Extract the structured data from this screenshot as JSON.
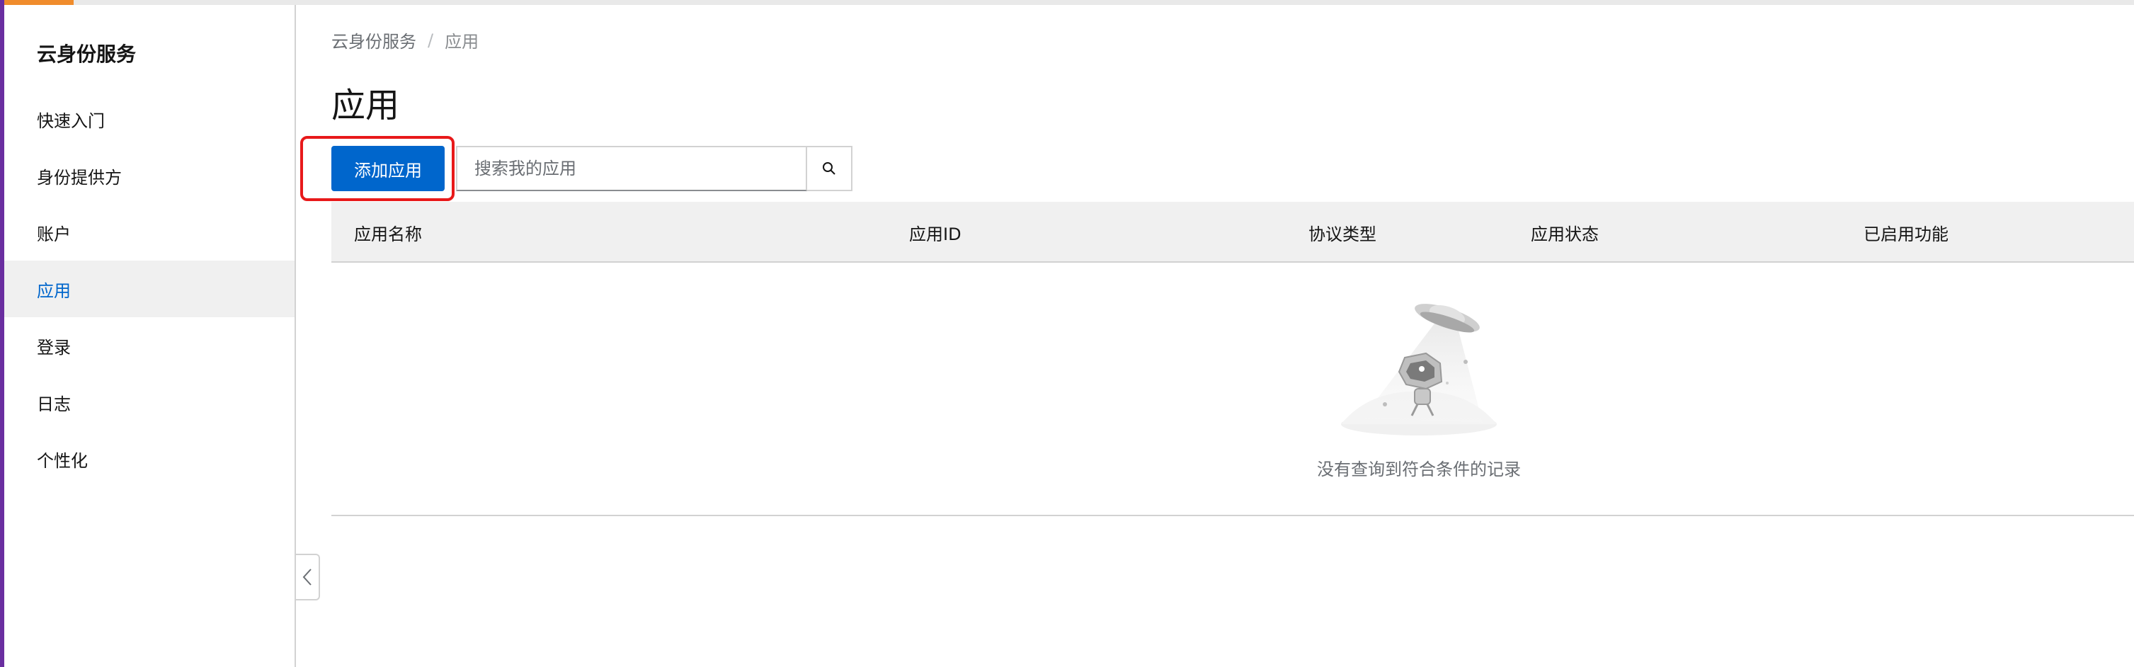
{
  "sidebar": {
    "title": "云身份服务",
    "items": [
      {
        "label": "快速入门",
        "active": false
      },
      {
        "label": "身份提供方",
        "active": false
      },
      {
        "label": "账户",
        "active": false
      },
      {
        "label": "应用",
        "active": true
      },
      {
        "label": "登录",
        "active": false
      },
      {
        "label": "日志",
        "active": false
      },
      {
        "label": "个性化",
        "active": false
      }
    ]
  },
  "breadcrumb": {
    "root": "云身份服务",
    "separator": "/",
    "current": "应用"
  },
  "page": {
    "title": "应用"
  },
  "toolbar": {
    "add_label": "添加应用",
    "search_placeholder": "搜索我的应用",
    "search_value": ""
  },
  "table": {
    "columns": [
      "应用名称",
      "应用ID",
      "协议类型",
      "应用状态",
      "已启用功能"
    ],
    "rows": [],
    "empty_text": "没有查询到符合条件的记录"
  },
  "icons": {
    "search": "search-icon",
    "collapse": "chevron-left-icon",
    "empty": "empty-state-ufo-illustration"
  },
  "colors": {
    "primary": "#0066cc",
    "active_text": "#0066cc",
    "highlight": "#e8191a",
    "accent_orange": "#f08c2c",
    "accent_purple": "#6a2ea0"
  }
}
